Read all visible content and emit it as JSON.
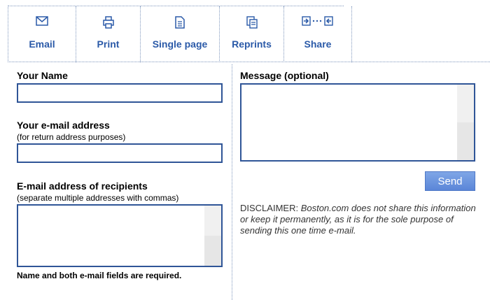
{
  "toolbar": {
    "items": [
      {
        "label": "Email",
        "icon": "envelope-icon"
      },
      {
        "label": "Print",
        "icon": "printer-icon"
      },
      {
        "label": "Single page",
        "icon": "document-icon"
      },
      {
        "label": "Reprints",
        "icon": "copies-icon"
      },
      {
        "label": "Share",
        "icon": "share-arrows-icon"
      }
    ]
  },
  "form": {
    "your_name": {
      "label": "Your Name",
      "value": ""
    },
    "your_email": {
      "label": "Your e-mail address",
      "hint": "(for return address purposes)",
      "value": ""
    },
    "recipients": {
      "label": "E-mail address of recipients",
      "hint": "(separate multiple addresses with commas)",
      "value": ""
    },
    "required_note": "Name and both e-mail fields are required.",
    "message": {
      "label": "Message (optional)",
      "value": ""
    },
    "send_label": "Send",
    "disclaimer_prefix": "DISCLAIMER: ",
    "disclaimer_text": "Boston.com does not share this information or keep it permanently, as it is for the sole purpose of sending this one time e-mail."
  },
  "colors": {
    "link_blue": "#2b5aa8",
    "field_border": "#2f5597",
    "send_button": "#6a95df",
    "divider": "#7f97bd"
  }
}
